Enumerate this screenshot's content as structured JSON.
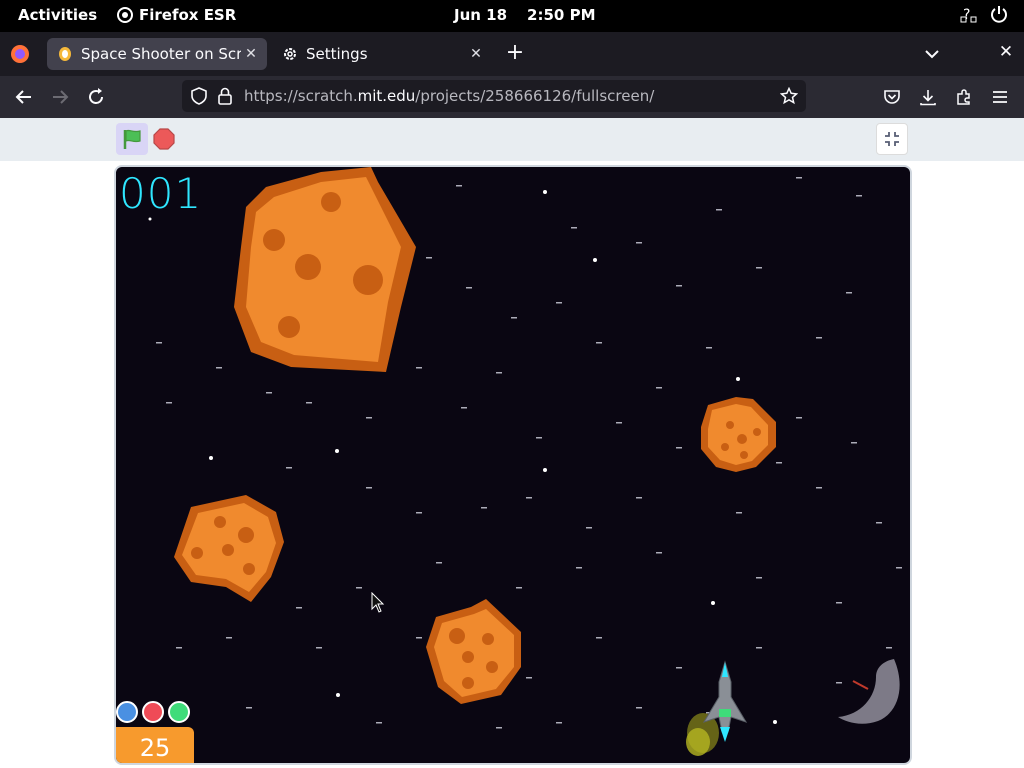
{
  "topbar": {
    "activities": "Activities",
    "app_name": "Firefox ESR",
    "date": "Jun 18",
    "time": "2:50 PM"
  },
  "tabs": [
    {
      "title": "Space Shooter on Scratch",
      "active": true,
      "icon": "scratch-favicon-icon"
    },
    {
      "title": "Settings",
      "active": false,
      "icon": "gear-icon"
    }
  ],
  "navbar": {
    "url_prefix": "https://scratch.",
    "url_domain": "mit.edu",
    "url_suffix": "/projects/258666126/fullscreen/"
  },
  "scratch": {
    "score_display": "001",
    "lives": [
      "#4a90e2",
      "#ef4b57",
      "#3fdc7a"
    ],
    "timer_value": "25"
  },
  "colors": {
    "stage_bg": "#0a0612",
    "asteroid_fill": "#f08a2e",
    "asteroid_edge": "#c85f13",
    "score_color": "#2fe6ff"
  }
}
